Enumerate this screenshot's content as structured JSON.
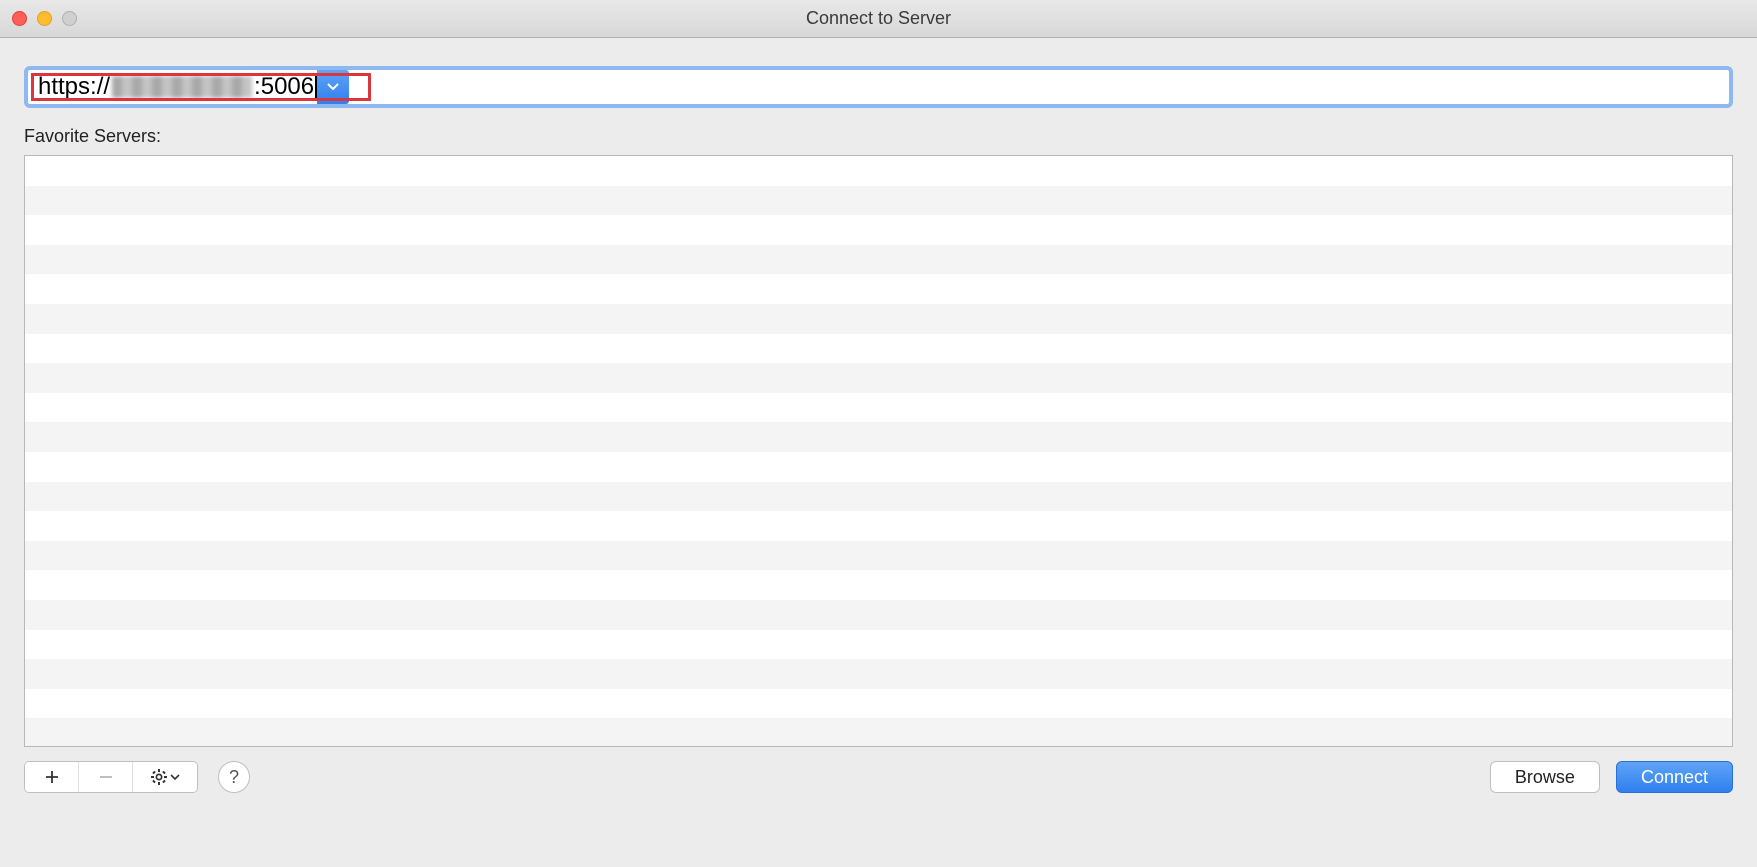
{
  "window": {
    "title": "Connect to Server"
  },
  "address": {
    "prefix": "https://",
    "redacted": true,
    "suffix": ":5006"
  },
  "favorites": {
    "label": "Favorite Servers:",
    "items": []
  },
  "toolbar": {
    "help_label": "?"
  },
  "buttons": {
    "browse": "Browse",
    "connect": "Connect"
  }
}
